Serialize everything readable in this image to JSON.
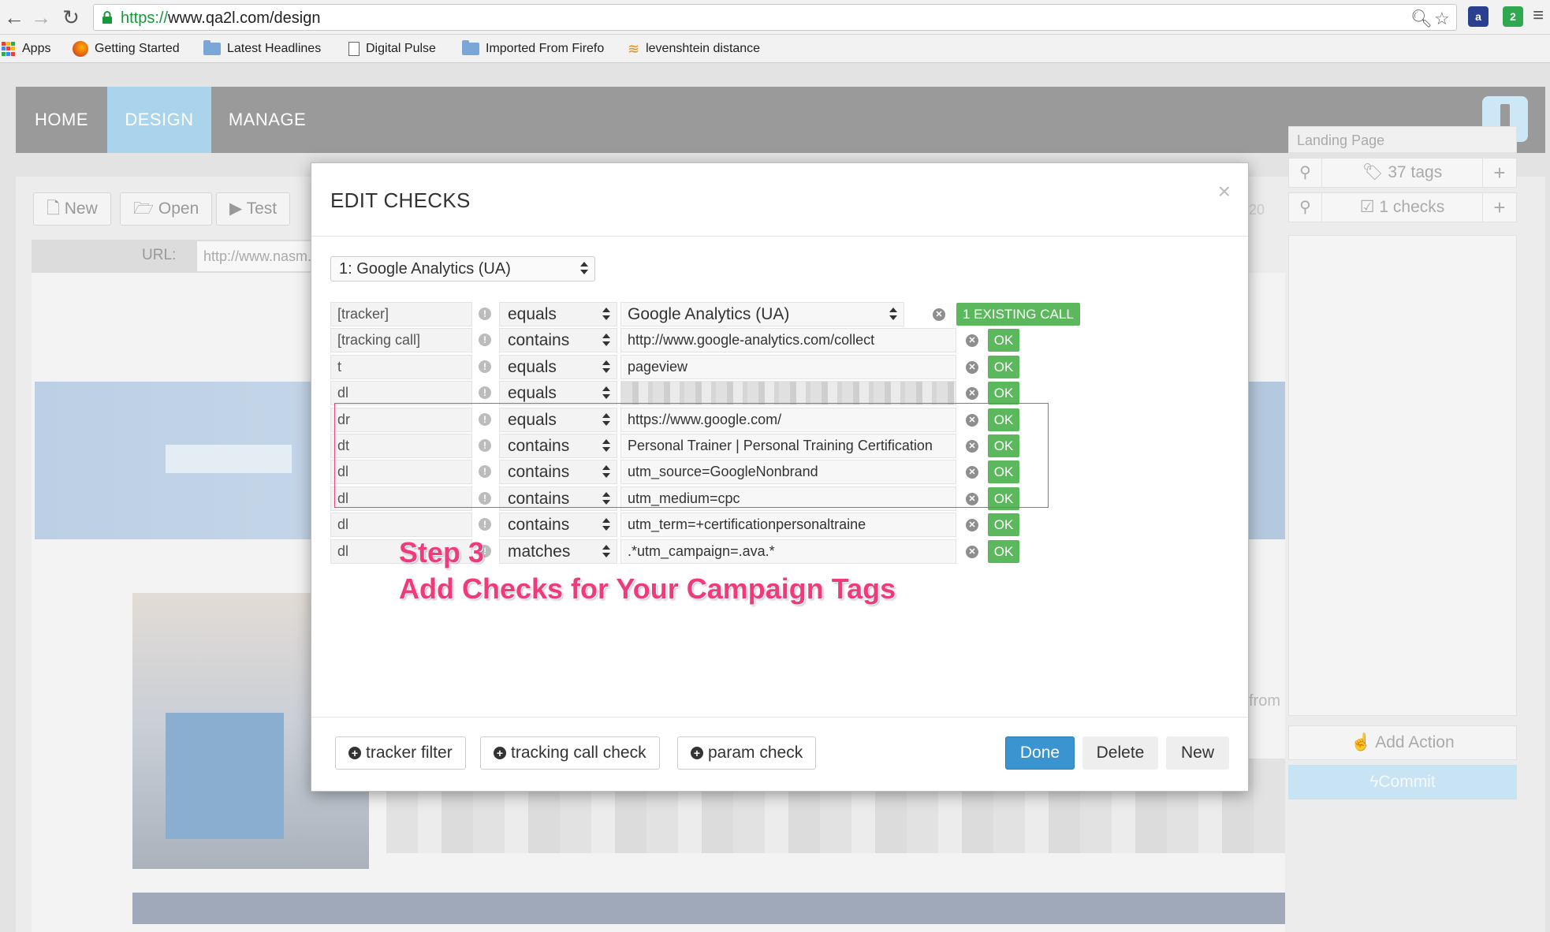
{
  "browser": {
    "url_scheme": "https://",
    "url_rest": "www.qa2l.com/design",
    "bookmarks": [
      "Apps",
      "Getting Started",
      "Latest Headlines",
      "Digital Pulse",
      "Imported From Firefo",
      "levenshtein distance"
    ],
    "ext1_label": "a",
    "ext2_label": "2"
  },
  "app": {
    "nav": [
      "HOME",
      "DESIGN",
      "MANAGE"
    ],
    "toolbar": [
      "New",
      "Open",
      "Test"
    ],
    "url_label": "URL:",
    "url_value": "http://www.nasm.org",
    "side_label": "Landing Page",
    "tags_count": "37 tags",
    "checks_count": "1 checks",
    "add_action": "Add Action",
    "commit": "Commit",
    "partial_20": "20",
    "partial_from": "from"
  },
  "modal": {
    "title": "EDIT CHECKS",
    "tracker": "1: Google Analytics (UA)",
    "existing_call": "1 EXISTING CALL",
    "ok": "OK",
    "rows": [
      {
        "key": "[tracker]",
        "op": "equals",
        "value": "Google Analytics (UA)"
      },
      {
        "key": "[tracking call]",
        "op": "contains",
        "value": "http://www.google-analytics.com/collect"
      },
      {
        "key": "t",
        "op": "equals",
        "value": "pageview"
      },
      {
        "key": "dl",
        "op": "equals",
        "value": ""
      },
      {
        "key": "dr",
        "op": "equals",
        "value": "https://www.google.com/"
      },
      {
        "key": "dt",
        "op": "contains",
        "value": "Personal Trainer | Personal Training Certification"
      },
      {
        "key": "dl",
        "op": "contains",
        "value": "utm_source=GoogleNonbrand"
      },
      {
        "key": "dl",
        "op": "contains",
        "value": "utm_medium=cpc"
      },
      {
        "key": "dl",
        "op": "contains",
        "value": "utm_term=+certificationpersonaltraine"
      },
      {
        "key": "dl",
        "op": "matches",
        "value": ".*utm_campaign=.ava.*"
      }
    ],
    "step_line1": "Step 3",
    "step_line2": "Add Checks for Your Campaign Tags",
    "buttons": {
      "tracker_filter": "tracker filter",
      "tracking_call_check": "tracking call check",
      "param_check": "param check",
      "done": "Done",
      "delete": "Delete",
      "new": "New"
    }
  },
  "colors": {
    "primary": "#3a94cf",
    "success": "#5cb85c",
    "annotation": "#ef3b7d",
    "nav_active": "#a9d4ec"
  }
}
